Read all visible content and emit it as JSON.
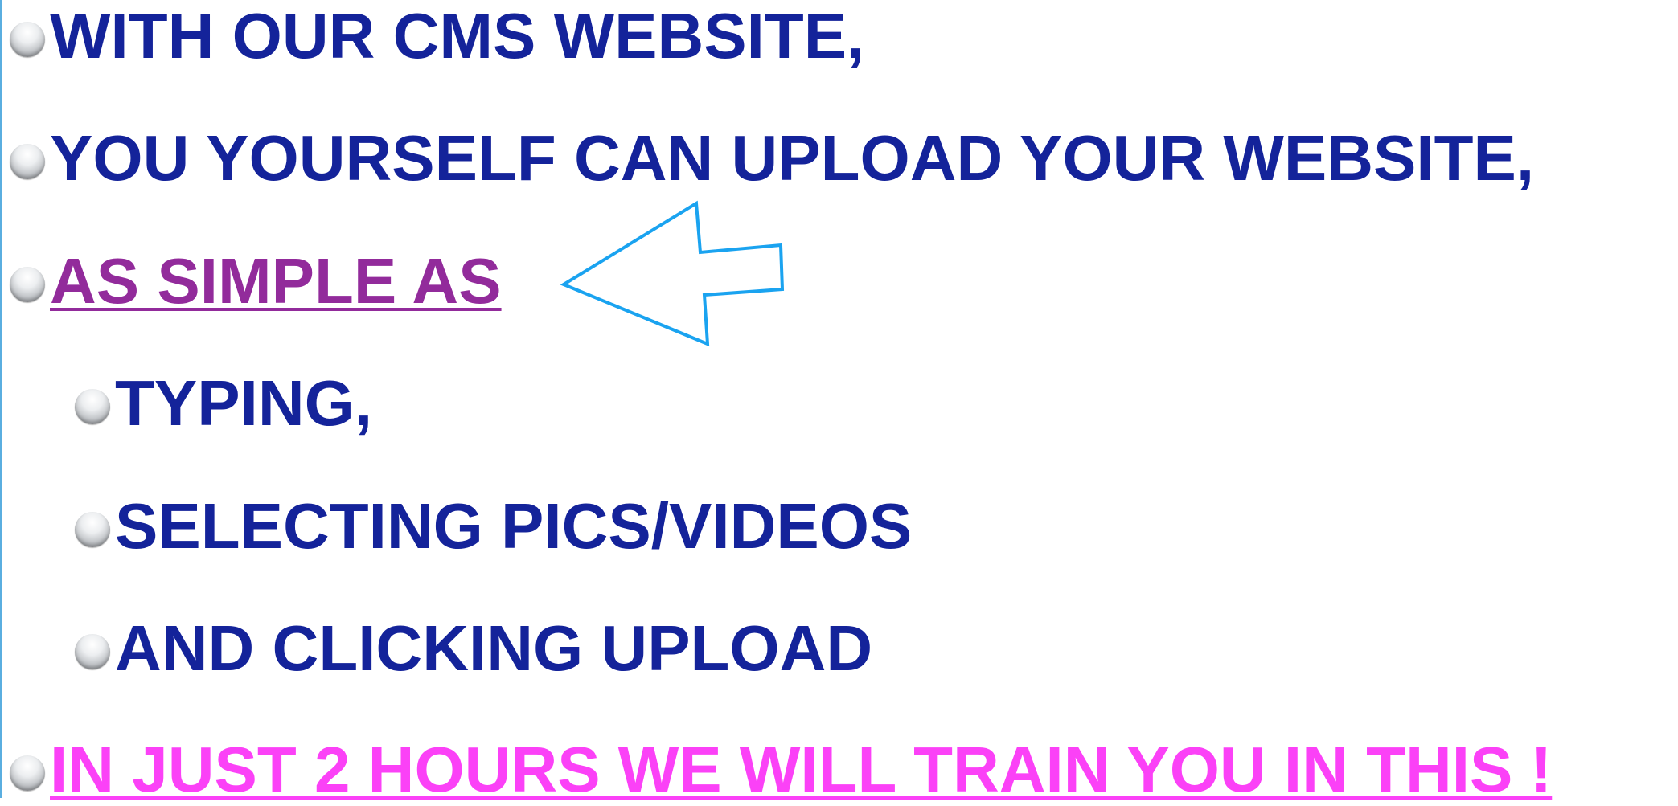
{
  "colors": {
    "text_navy": "#14239a",
    "text_purple": "#922b9b",
    "text_magenta": "#fb41f7",
    "arrow_stroke": "#1aa3f0",
    "bullet": "#c9cbce"
  },
  "icons": {
    "bullet": "gray-sphere-bullet-icon",
    "arrow": "left-arrow-outline-icon"
  },
  "bullets": [
    {
      "text": "WITH OUR CMS WEBSITE,"
    },
    {
      "text": "YOU YOURSELF CAN UPLOAD YOUR WEBSITE,"
    },
    {
      "text": "AS SIMPLE AS"
    },
    {
      "text": "TYPING,"
    },
    {
      "text": "SELECTING PICS/VIDEOS"
    },
    {
      "text": "AND CLICKING UPLOAD"
    },
    {
      "text": "IN JUST 2 HOURS WE WILL TRAIN YOU IN THIS !"
    }
  ]
}
